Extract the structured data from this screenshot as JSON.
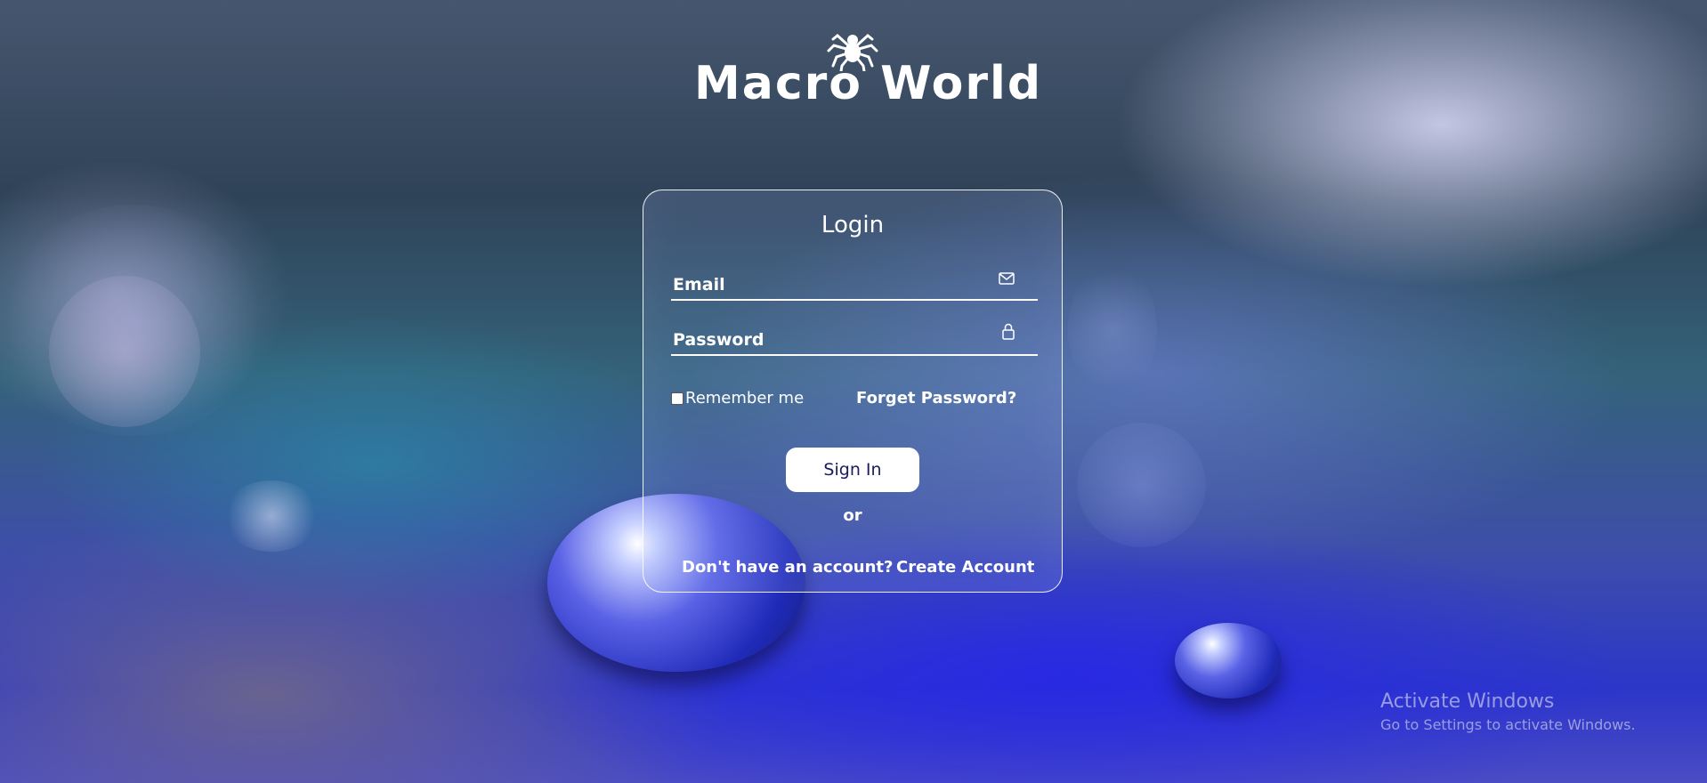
{
  "logo": {
    "text": "Macro World",
    "icon": "spider-icon"
  },
  "login": {
    "title": "Login",
    "email_label": "Email",
    "email_icon": "mail-icon",
    "password_label": "Password",
    "password_icon": "lock-icon",
    "remember_label": "Remember me",
    "remember_checked": false,
    "forgot_label": "Forget Password?",
    "signin_label": "Sign In",
    "or_text": "or",
    "no_account_text": "Don't have an account?",
    "create_account_label": "Create Account"
  },
  "watermark": {
    "title": "Activate Windows",
    "subtitle": "Go to Settings to activate Windows."
  },
  "colors": {
    "text": "#ffffff",
    "button_background": "#ffffff",
    "button_text": "#1c1a5e"
  }
}
